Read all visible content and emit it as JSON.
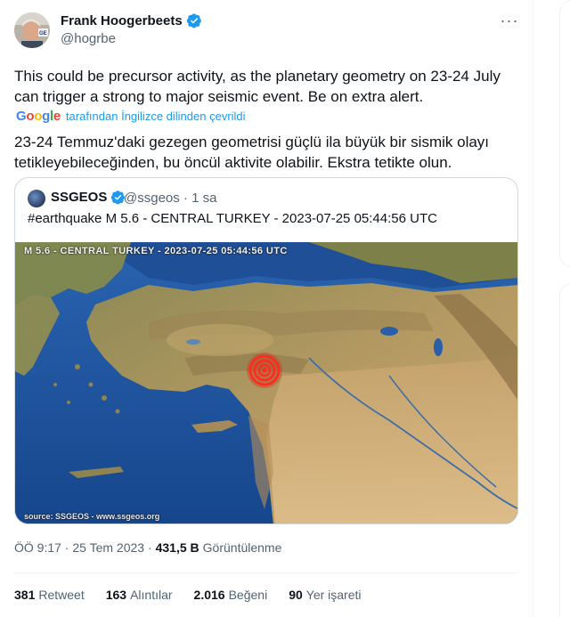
{
  "author": {
    "name": "Frank Hoogerbeets",
    "handle": "@hogrbe"
  },
  "more_icon": "more-horizontal-icon",
  "tweet": {
    "text": "This could be precursor activity, as the planetary geometry on 23-24 July can trigger a strong to major seismic event. Be on extra alert.",
    "translate_logo": "Google",
    "translate_label": "tarafından İngilizce dilinden çevrildi",
    "translated_text": "23-24 Temmuz'daki gezegen geometrisi güçlü ila büyük bir sismik olayı tetikleyebileceğinden, bu öncül aktivite olabilir. Ekstra tetikte olun."
  },
  "quote": {
    "name": "SSGEOS",
    "meta": "@ssgeos · 1 sa",
    "text": "#earthquake M 5.6 - CENTRAL TURKEY - 2023-07-25 05:44:56 UTC",
    "map_title": "M 5.6 - CENTRAL TURKEY - 2023-07-25 05:44:56 UTC",
    "map_source": "source: SSGEOS - www.ssgeos.org"
  },
  "timestamp": {
    "time_date": "ÖÖ 9:17 · 25 Tem 2023 ·",
    "views_count": "431,5 B",
    "views_label": "Görüntülenme"
  },
  "stats": {
    "retweets_count": "381",
    "retweets_label": "Retweet",
    "quotes_count": "163",
    "quotes_label": "Alıntılar",
    "likes_count": "2.016",
    "likes_label": "Beğeni",
    "bookmarks_count": "90",
    "bookmarks_label": "Yer işareti"
  },
  "colors": {
    "verified": "#1d9bf0",
    "link": "#1d9bf0",
    "secondary_text": "#536471"
  }
}
